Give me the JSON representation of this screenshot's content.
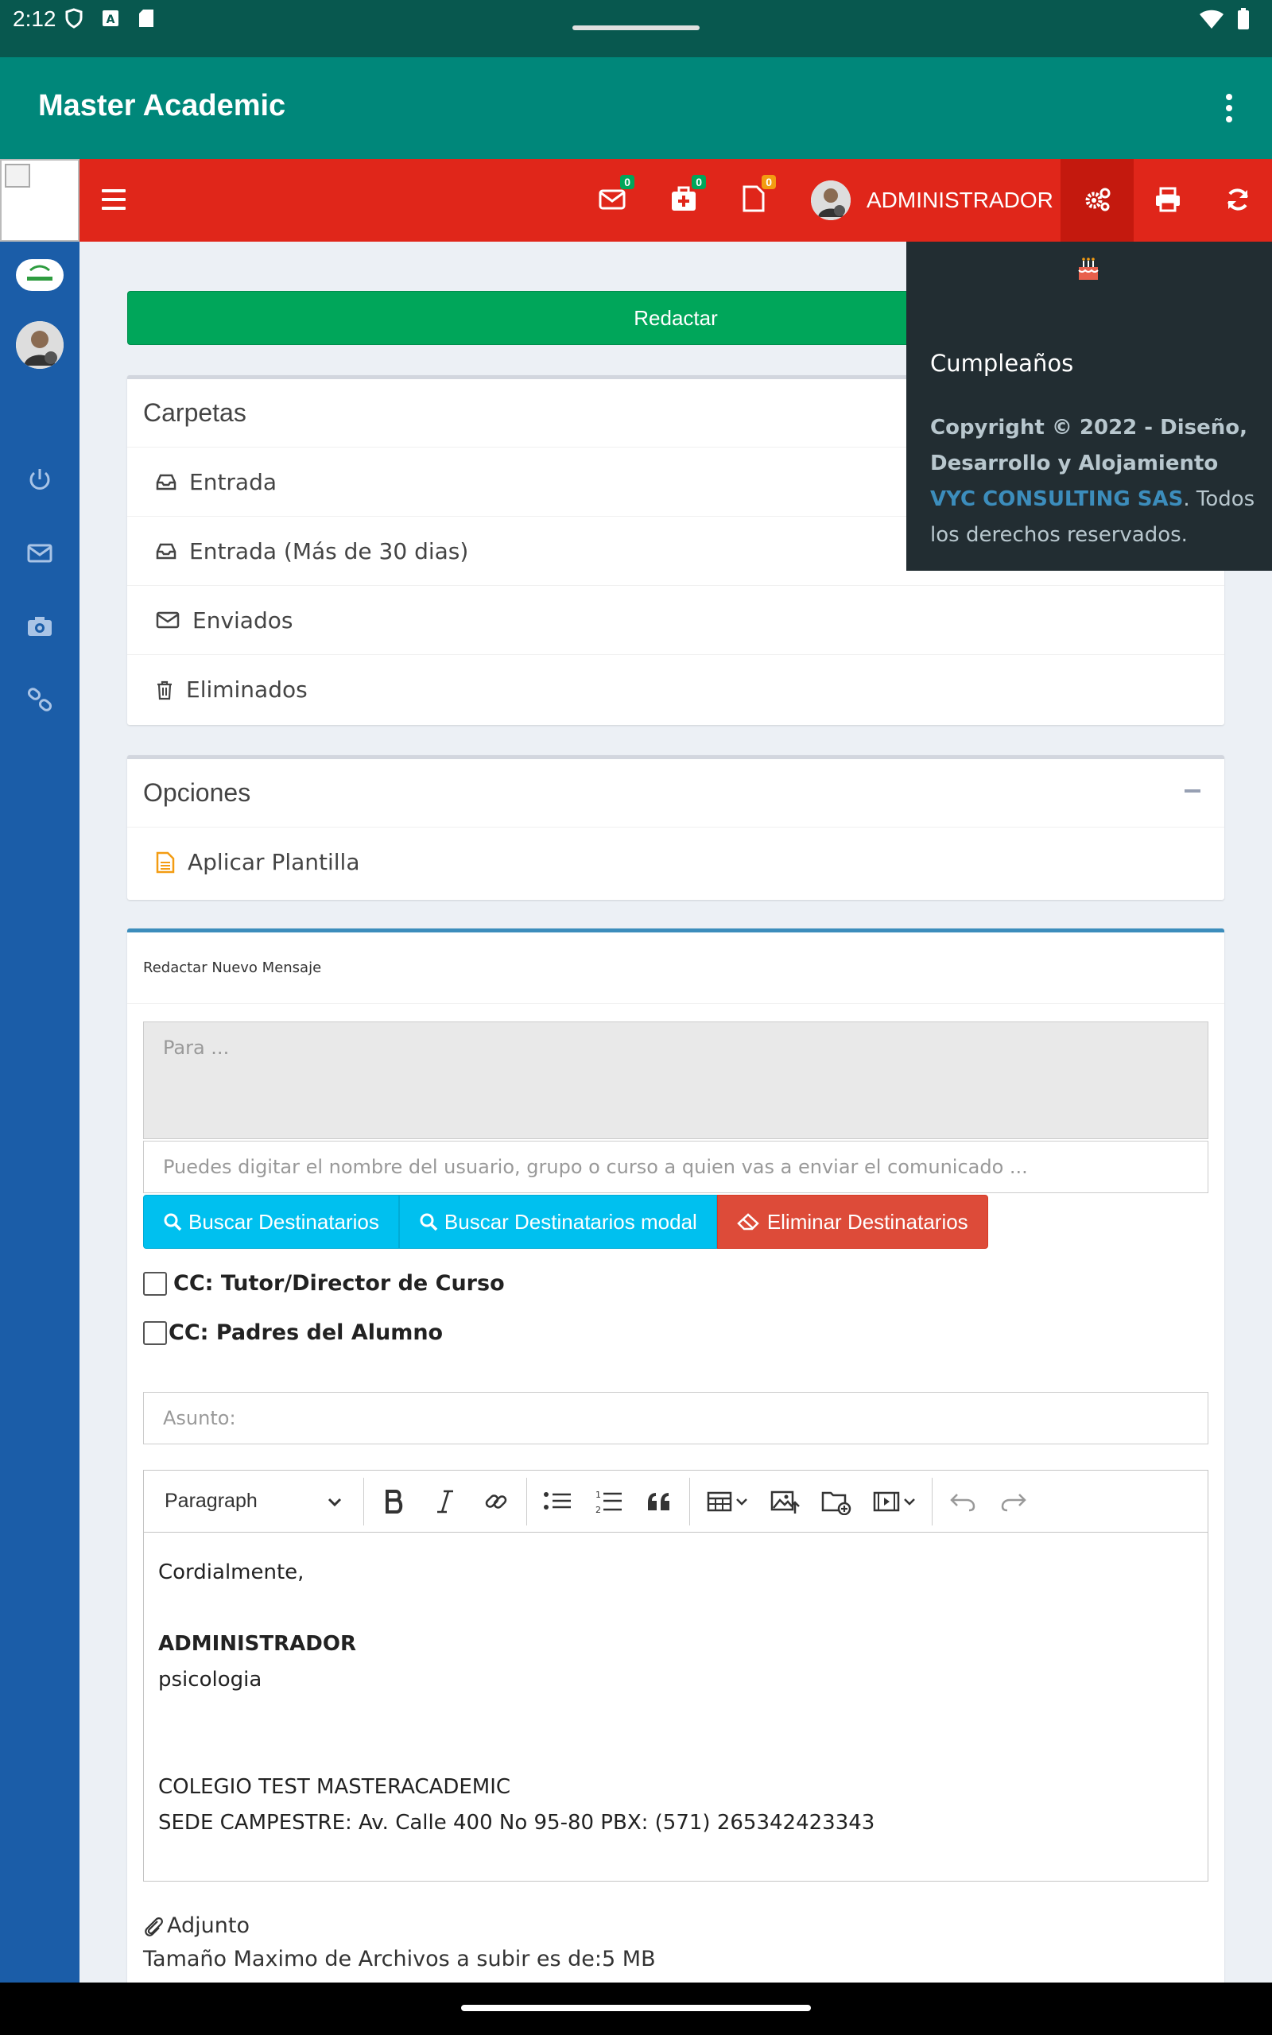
{
  "status_bar": {
    "time": "2:12"
  },
  "app_bar": {
    "title": "Master Academic"
  },
  "navbar": {
    "badges": {
      "messages": "0",
      "medical": "0",
      "documents": "0"
    },
    "user_label": "ADMINISTRADOR"
  },
  "main": {
    "compose_button": "Redactar",
    "folders": {
      "title": "Carpetas",
      "items": [
        {
          "label": "Entrada",
          "icon": "inbox-icon"
        },
        {
          "label": "Entrada (Más de 30 dias)",
          "icon": "inbox-icon"
        },
        {
          "label": "Enviados",
          "icon": "envelope-icon"
        },
        {
          "label": "Eliminados",
          "icon": "trash-icon"
        }
      ]
    },
    "options": {
      "title": "Opciones",
      "items": [
        {
          "label": "Aplicar Plantilla",
          "icon": "file-text-icon"
        }
      ]
    },
    "compose": {
      "title": "Redactar Nuevo Mensaje",
      "to_placeholder": "Para ...",
      "hint_placeholder": "Puedes digitar el nombre del usuario, grupo o curso a quien vas a enviar el comunicado ...",
      "buttons": {
        "search": "Buscar Destinatarios",
        "search_modal": "Buscar Destinatarios modal",
        "delete": "Eliminar Destinatarios"
      },
      "cc_tutor": "CC: Tutor/Director de Curso",
      "cc_parents": "CC: Padres del Alumno",
      "subject_placeholder": "Asunto:",
      "editor": {
        "format_select": "Paragraph",
        "body": {
          "line1": "Cordialmente,",
          "name": "ADMINISTRADOR",
          "role": "psicologia",
          "school": "COLEGIO TEST MASTERACADEMIC",
          "address": "SEDE CAMPESTRE: Av. Calle 400 No 95-80 PBX: (571) 265342423343"
        }
      },
      "attachment_label": "Adjunto",
      "attachment_note": "Tamaño Maximo de Archivos a subir es de:5 MB"
    }
  },
  "dropdown": {
    "birthday_title": "Cumpleaños",
    "copyright_bold": "Copyright © 2022 - Diseño, Desarrollo y Alojamiento",
    "company": "VYC CONSULTING SAS",
    "rights": ". Todos los derechos reservados."
  },
  "colors": {
    "app_bar": "#00877a",
    "navbar": "#e0261a",
    "sidebar": "#1b5da8",
    "success": "#00a65a",
    "info": "#00c0ef",
    "danger": "#dd4b39",
    "dropdown_bg": "#222d32"
  }
}
